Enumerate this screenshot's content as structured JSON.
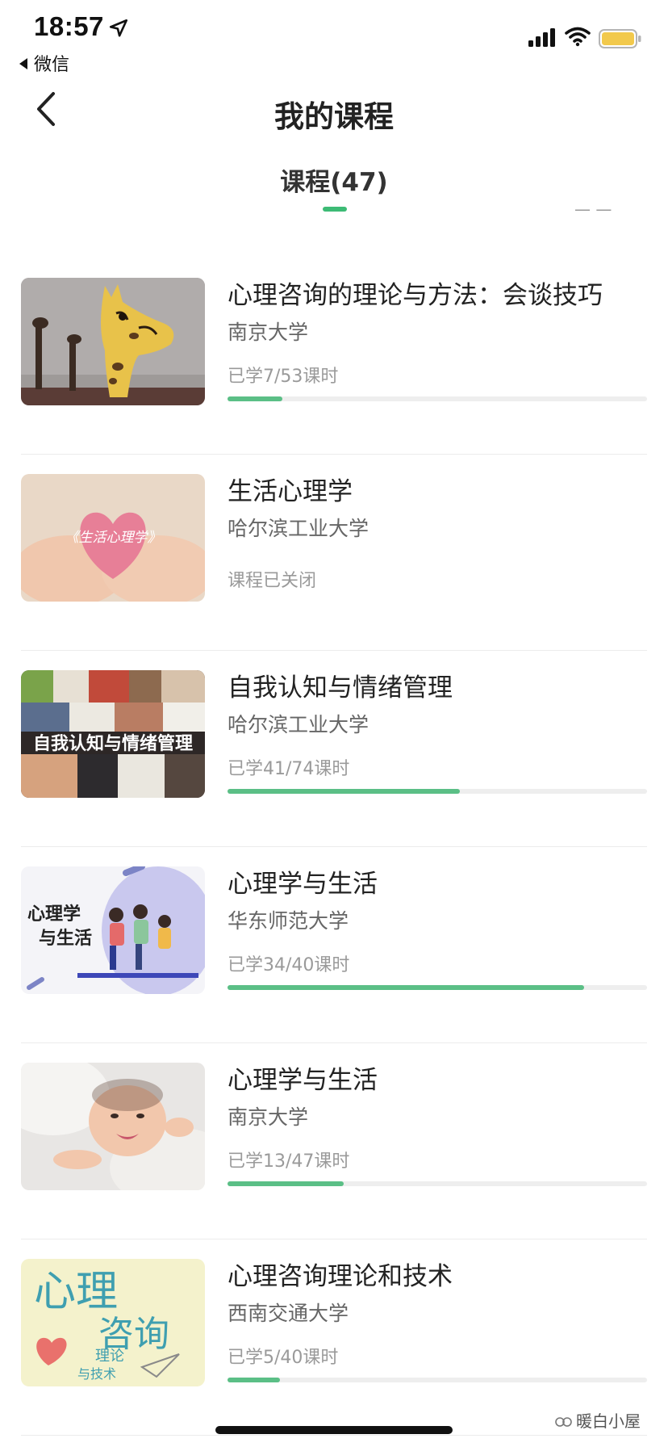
{
  "status_bar": {
    "time": "18:57",
    "back_app": "微信",
    "battery_color": "#f2c94c"
  },
  "nav": {
    "title": "我的课程"
  },
  "tab": {
    "label": "课程(47)",
    "accent": "#3dbb75"
  },
  "courses": [
    {
      "title": "心理咨询的理论与方法：会谈技巧",
      "school": "南京大学",
      "status": "已学7/53课时",
      "progress": 0.13
    },
    {
      "title": "生活心理学",
      "school": "哈尔滨工业大学",
      "status": "课程已关闭",
      "progress": null
    },
    {
      "title": "自我认知与情绪管理",
      "school": "哈尔滨工业大学",
      "status": "已学41/74课时",
      "progress": 0.554
    },
    {
      "title": "心理学与生活",
      "school": "华东师范大学",
      "status": "已学34/40课时",
      "progress": 0.85
    },
    {
      "title": "心理学与生活",
      "school": "南京大学",
      "status": "已学13/47课时",
      "progress": 0.277
    },
    {
      "title": "心理咨询理论和技术",
      "school": "西南交通大学",
      "status": "已学5/40课时",
      "progress": 0.125
    }
  ],
  "thumbnails": {
    "t2_text": "《生活心理学》",
    "t3_text": "自我认知与情绪管理",
    "t4_text_1": "心理学",
    "t4_text_2": "与生活",
    "t6_text_1": "心理",
    "t6_text_2": "咨询",
    "t6_text_3": "理论",
    "t6_text_4": "与技术"
  },
  "watermark": "暖白小屋"
}
